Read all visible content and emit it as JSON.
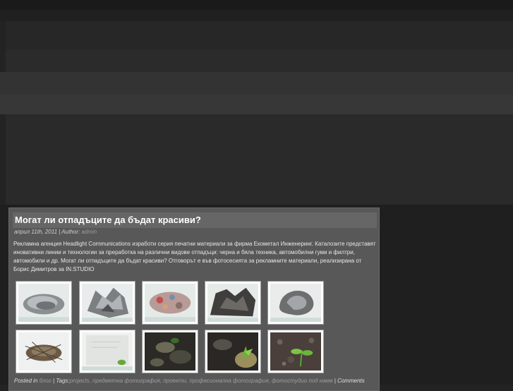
{
  "post": {
    "title": "Могат ли отпадъците да бъдат красиви?",
    "date": "април 11th, 2011",
    "author_prefix": "Author:",
    "author": "admin",
    "body": "Рекламна агенция Headlight Communications изработи серия печатни материали за фирма Екометал Инженеринг. Каталозите представят иновативни линии и технологии за преработка на различни видове отпадъци: черна и бяла техника, автомобилни гуми и филтри, автомобили и др. Могат ли отпадъците да бъдат красиви? Отговорът е във фотосесията за рекламните материали, реализирана от Борис Димитров за IN.STUDIO",
    "thumbnails": [
      "metal-shavings-thumbnail",
      "crushed-metal-thumbnail",
      "colored-scrap-thumbnail",
      "dark-scrap-pile-thumbnail",
      "metal-sculpture-thumbnail",
      "nest-debris-thumbnail",
      "paper-sprout-thumbnail",
      "dark-soil-thumbnail",
      "soil-sprout-thumbnail",
      "gravel-sprout-thumbnail"
    ],
    "footer": {
      "posted_in": "Posted in",
      "category": "блог",
      "sep1": " | Tags:",
      "tags": "projects, предметна фотография, проекти, професионална фотография, фотостудио под наем",
      "sep2": " |",
      "comments": "Comments"
    }
  }
}
